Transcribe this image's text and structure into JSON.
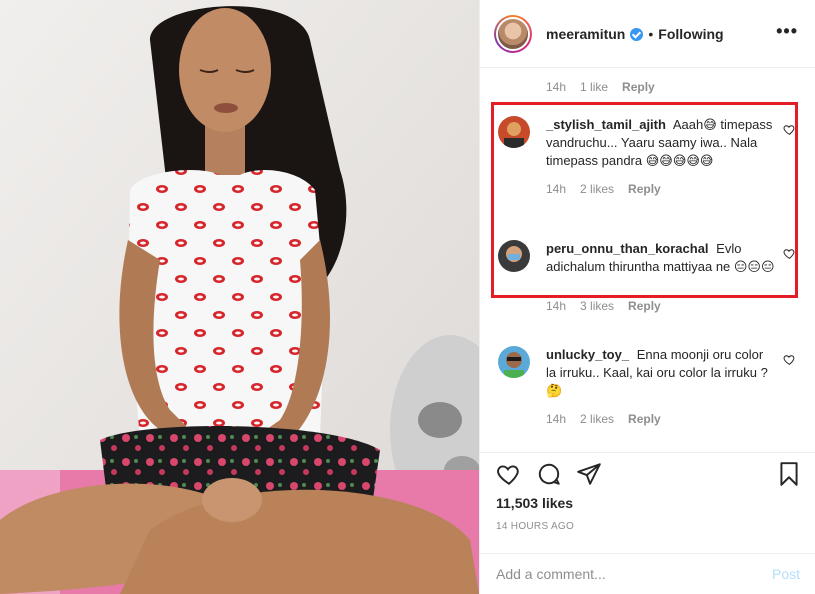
{
  "post": {
    "author": "meeramitun",
    "follow_state": "Following",
    "more_label": "•••"
  },
  "comments": [
    {
      "time": "14h",
      "likes": "1 like",
      "reply": "Reply"
    },
    {
      "username": "_stylish_tamil_ajith",
      "text": "Aaah😅 timepass vandruchu... Yaaru saamy iwa.. Nala timepass pandra 😅😅😅😅😅",
      "time": "14h",
      "likes": "2 likes",
      "reply": "Reply"
    },
    {
      "username": "peru_onnu_than_korachal",
      "text": "Evlo adichalum thiruntha mattiyaa ne 😑😑😑",
      "time": "14h",
      "likes": "3 likes",
      "reply": "Reply"
    },
    {
      "username": "unlucky_toy_",
      "text": "Enna moonji oru color la irruku.. Kaal, kai oru color la irruku ? 🤔",
      "time": "14h",
      "likes": "2 likes",
      "reply": "Reply"
    }
  ],
  "likes_count": "11,503 likes",
  "time_ago": "14 HOURS AGO",
  "add_comment": {
    "placeholder": "Add a comment...",
    "post_label": "Post"
  },
  "colors": {
    "highlight": "#e51d24",
    "verified": "#3897f0",
    "post_disabled": "#b2dffc"
  }
}
